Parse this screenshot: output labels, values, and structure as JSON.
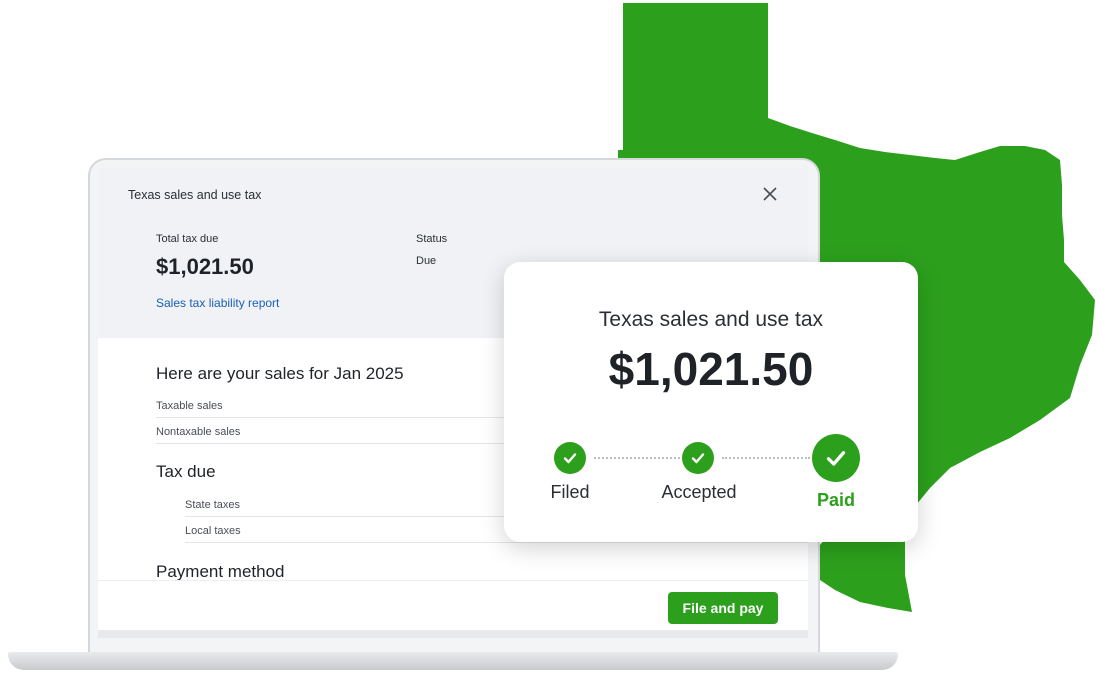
{
  "colors": {
    "brand_green": "#2ca01c",
    "link_blue": "#1a5fb4"
  },
  "panel": {
    "title": "Texas sales and use tax",
    "close_icon": "close-icon",
    "total_tax_due_label": "Total tax due",
    "total_tax_due_value": "$1,021.50",
    "status_label": "Status",
    "status_value": "Due",
    "report_link": "Sales tax liability report"
  },
  "sales": {
    "heading": "Here are your sales for Jan 2025",
    "rows": [
      "Taxable sales",
      "Nontaxable sales"
    ]
  },
  "tax_due": {
    "heading": "Tax due",
    "rows": [
      "State taxes",
      "Local taxes"
    ]
  },
  "payment": {
    "heading": "Payment method"
  },
  "footer": {
    "file_pay_label": "File and pay"
  },
  "card": {
    "title": "Texas sales and use tax",
    "amount": "$1,021.50",
    "steps": [
      {
        "label": "Filed",
        "icon": "check-icon"
      },
      {
        "label": "Accepted",
        "icon": "check-icon"
      },
      {
        "label": "Paid",
        "icon": "check-icon"
      }
    ]
  }
}
